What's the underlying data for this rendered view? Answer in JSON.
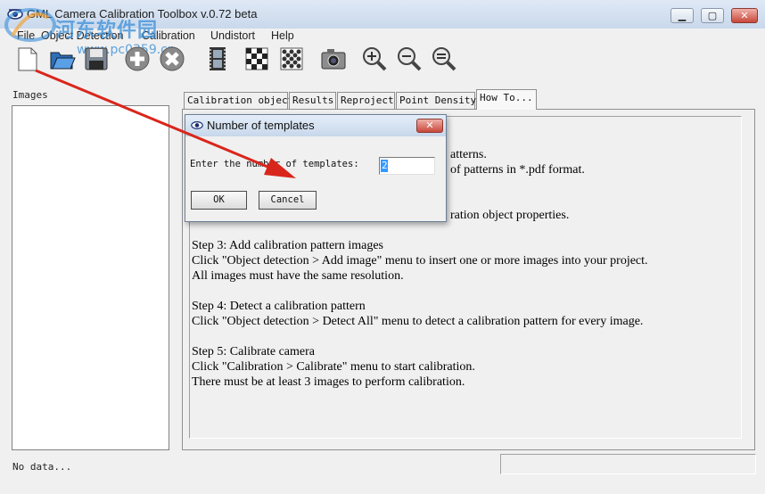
{
  "window": {
    "title": "GML Camera Calibration Toolbox  v.0.72 beta"
  },
  "menu": [
    "File",
    "Object Detection",
    "Calibration",
    "Undistort",
    "Help"
  ],
  "watermark": {
    "text": "河东软件园",
    "url": "www.pc0359.cn"
  },
  "toolbar": {
    "icons": [
      "new-file-icon",
      "open-folder-icon",
      "save-disk-icon",
      "add-image-icon",
      "remove-image-icon",
      "film-strip-icon",
      "checkerboard-icon",
      "circle-grid-icon",
      "camera-icon",
      "zoom-in-icon",
      "zoom-out-icon",
      "zoom-fit-icon"
    ]
  },
  "images_panel": {
    "label": "Images"
  },
  "tabs": [
    "Calibration object",
    "Results",
    "Reproject",
    "Point Density",
    "How To..."
  ],
  "active_tab": "How To...",
  "howto": {
    "partial1": "atterns.",
    "partial2": "of patterns in *.pdf format.",
    "partial3": "ration object properties.",
    "step3_title": "Step 3: Add calibration pattern images",
    "step3_line1": "Click  \"Object detection > Add image\"  menu to insert one or more images into your project.",
    "step3_line2": "All images must have the same resolution.",
    "step4_title": "Step 4: Detect a calibration pattern",
    "step4_line1": "Click  \"Object detection > Detect All\"  menu to detect a calibration pattern for every image.",
    "step5_title": "Step 5: Calibrate camera",
    "step5_line1": "Click  \"Calibration > Calibrate\"  menu to start calibration.",
    "step5_line2": "There must be at least 3 images to perform calibration."
  },
  "status": {
    "text": "No data..."
  },
  "dialog": {
    "title": "Number of templates",
    "label": "Enter the number of templates:",
    "value": "2",
    "ok": "OK",
    "cancel": "Cancel"
  },
  "colors": {
    "annotation_arrow": "#d9261c",
    "selection": "#3399ff",
    "titlebar": "#c9d8ec"
  }
}
